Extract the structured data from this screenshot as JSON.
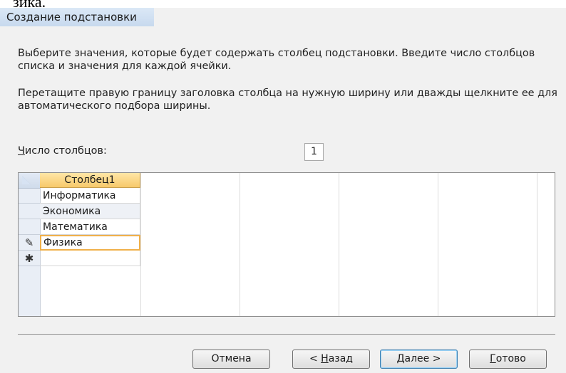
{
  "page_fragment": "зика.",
  "dialog": {
    "title": "Создание подстановки",
    "instruction_1": "Выберите значения, которые будет содержать столбец подстановки. Введите число столбцов списка и значения для каждой ячейки.",
    "instruction_2": "Перетащите правую границу заголовка столбца на нужную ширину или дважды щелкните ее для автоматического подбора ширины.",
    "columns_label_accel": "Ч",
    "columns_label_rest": "исло столбцов:",
    "columns_value": "1"
  },
  "grid": {
    "header": "Столбец1",
    "rows": [
      "Информатика",
      "Экономика",
      "Математика",
      "Физика"
    ],
    "active_row_index": 3,
    "edit_marker": "✎",
    "new_row_marker": "✱"
  },
  "buttons": {
    "cancel": "Отмена",
    "back_prefix": "< ",
    "back_accel": "Н",
    "back_rest": "азад",
    "next_accel": "Д",
    "next_rest": "алее >",
    "finish_accel": "Г",
    "finish_rest": "отово"
  }
}
